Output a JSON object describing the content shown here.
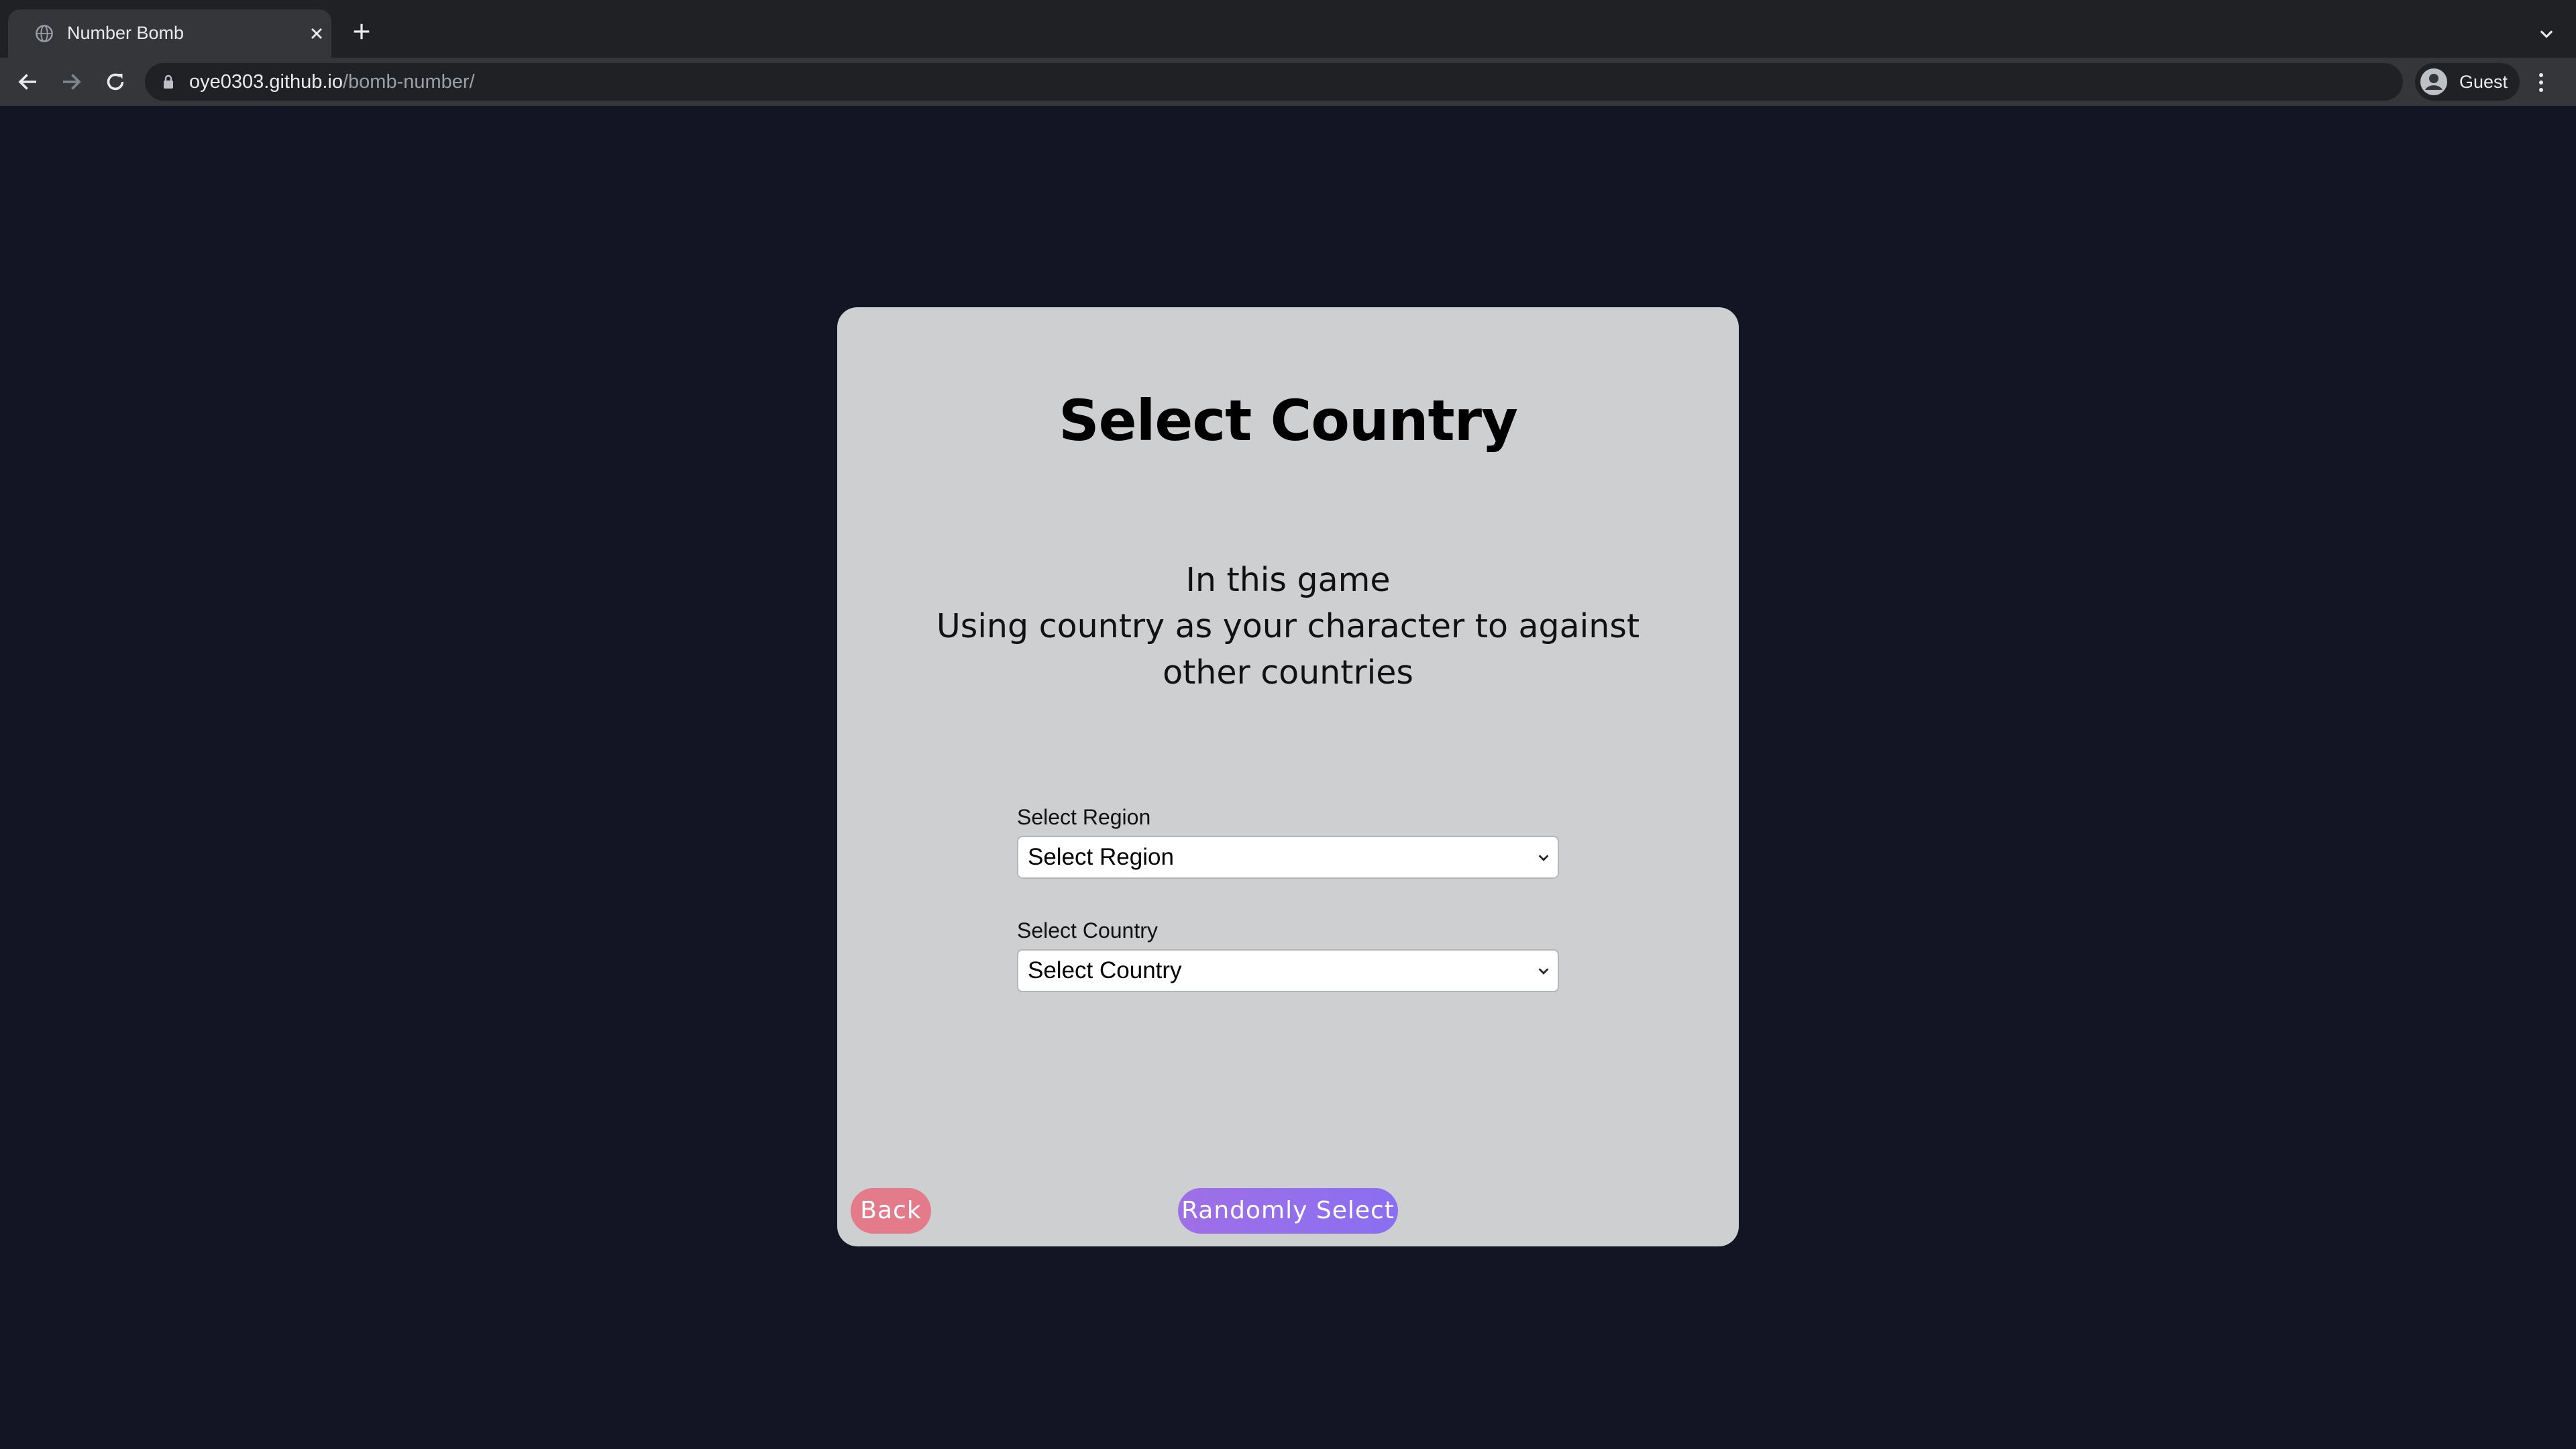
{
  "browser": {
    "tab_title": "Number Bomb",
    "url_host": "oye0303.github.io",
    "url_path": "/bomb-number/",
    "profile_label": "Guest"
  },
  "page": {
    "title": "Select Country",
    "description_line1": "In this game",
    "description_line2": "Using country as your character to against other countries",
    "region_label": "Select Region",
    "region_selected": "Select Region",
    "country_label": "Select Country",
    "country_selected": "Select Country",
    "back_label": "Back",
    "random_label": "Randomly Select"
  },
  "colors": {
    "background": "#131524",
    "card": "#cecfd1",
    "back_button": "#e37b8a",
    "random_button": "#9f6fe6"
  }
}
